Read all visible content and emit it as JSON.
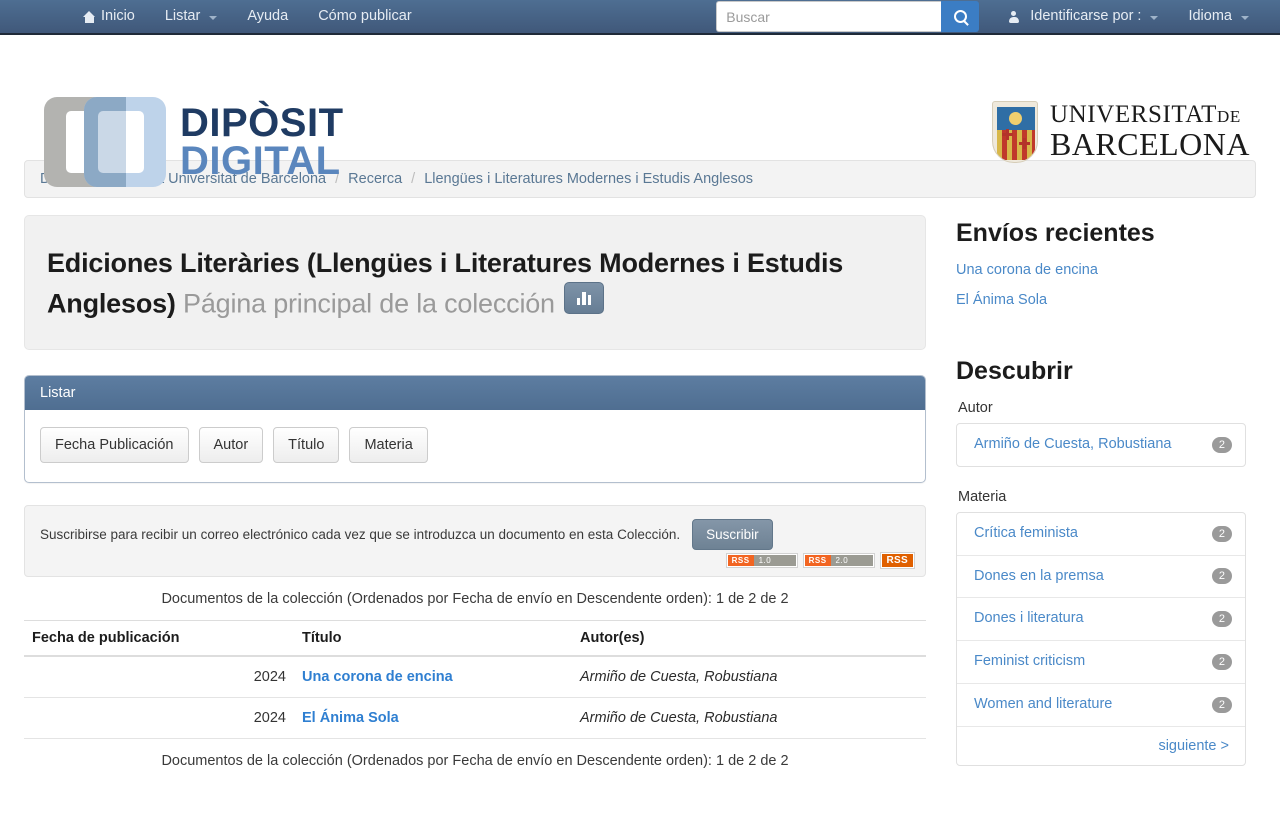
{
  "navbar": {
    "items": [
      {
        "label": "Inicio",
        "icon": "home-icon",
        "caret": false
      },
      {
        "label": "Listar",
        "icon": null,
        "caret": true
      },
      {
        "label": "Ayuda",
        "icon": null,
        "caret": false
      },
      {
        "label": "Cómo publicar",
        "icon": null,
        "caret": false
      }
    ],
    "search": {
      "placeholder": "Buscar",
      "value": "",
      "button_icon": "search-icon"
    },
    "login_label": "Identificarse por :",
    "language_label": "Idioma"
  },
  "header": {
    "logo": {
      "word1": "DIPÒSIT",
      "word2": "DIGITAL"
    },
    "university": {
      "line1": "UNIVERSITAT",
      "line1_small": "DE",
      "line2": "BARCELONA"
    }
  },
  "breadcrumb": {
    "items": [
      "Dipòsit Digital de la Universitat de Barcelona",
      "Recerca",
      "Llengües i Literatures Modernes i Estudis Anglesos"
    ],
    "separator": "/"
  },
  "jumbotron": {
    "title": "Ediciones Literàries (Llengües i Literatures Modernes i Estudis Anglesos)",
    "subtitle": "Página principal de la colección",
    "stats_icon": "bar-chart-icon"
  },
  "browse_panel": {
    "heading": "Listar",
    "buttons": [
      "Fecha Publicación",
      "Autor",
      "Título",
      "Materia"
    ]
  },
  "subscribe": {
    "text": "Suscribirse para recibir un correo electrónico cada vez que se introduzca un documento en esta Colección.",
    "button_label": "Suscribir",
    "rss": [
      {
        "label": "RSS",
        "version": "1.0",
        "style": "split"
      },
      {
        "label": "RSS",
        "version": "2.0",
        "style": "split"
      },
      {
        "label": "RSS",
        "version": "",
        "style": "solid"
      }
    ]
  },
  "documents": {
    "caption_top": "Documentos de la colección (Ordenados por Fecha de envío en Descendente orden): 1 de 2 de 2",
    "caption_bottom": "Documentos de la colección (Ordenados por Fecha de envío en Descendente orden): 1 de 2 de 2",
    "columns": [
      "Fecha de publicación",
      "Título",
      "Autor(es)"
    ],
    "rows": [
      {
        "date": "2024",
        "title": "Una corona de encina",
        "authors": "Armiño de Cuesta, Robustiana"
      },
      {
        "date": "2024",
        "title": "El Ánima Sola",
        "authors": "Armiño de Cuesta, Robustiana"
      }
    ]
  },
  "sidebar": {
    "recent": {
      "heading": "Envíos recientes",
      "items": [
        "Una corona de encina",
        "El Ánima Sola"
      ]
    },
    "discover": {
      "heading": "Descubrir",
      "facets": [
        {
          "label": "Autor",
          "items": [
            {
              "name": "Armiño de Cuesta, Robustiana",
              "count": "2"
            }
          ],
          "next_label": null
        },
        {
          "label": "Materia",
          "items": [
            {
              "name": "Crítica feminista",
              "count": "2"
            },
            {
              "name": "Dones en la premsa",
              "count": "2"
            },
            {
              "name": "Dones i literatura",
              "count": "2"
            },
            {
              "name": "Feminist criticism",
              "count": "2"
            },
            {
              "name": "Women and literature",
              "count": "2"
            }
          ],
          "next_label": "siguiente >"
        }
      ]
    }
  },
  "colors": {
    "navbar": "#4e6e92",
    "accent_link": "#4a89c8",
    "panel_header": "#5d7da1",
    "rss_orange": "#f26522",
    "badge_gray": "#9a9a9a"
  }
}
